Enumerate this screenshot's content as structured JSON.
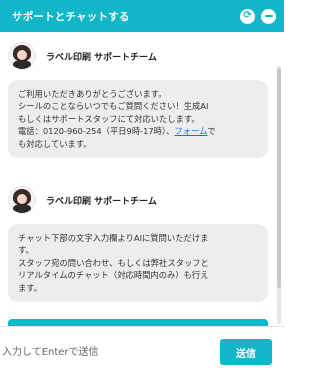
{
  "header": {
    "title": "サポートとチャットする",
    "refresh_glyph": "⟳",
    "minimize_label": "—"
  },
  "messages": [
    {
      "sender": "ラベル印刷 サポートチーム",
      "lines": [
        "ご利用いただきありがとうございます。",
        "シールのことならいつでもご質問ください！生成AI",
        "もしくはサポートスタッフにて対応いたします。"
      ],
      "phone_prefix": "電話：0120-960-254（平日9時-17時）、",
      "link_text": "フォーム",
      "phone_suffix": "で",
      "last_line": "も対応しています。"
    },
    {
      "sender": "ラベル印刷 サポートチーム",
      "lines": [
        "チャット下部の文字入力欄よりAIに質問いただけま",
        "す。",
        "スタッフ宛の問い合わせ、もしくは弊社スタッフと",
        "リアルタイムのチャット（対応時間内のみ）も行え",
        "ます。"
      ]
    }
  ],
  "input": {
    "placeholder": "入力してEnterで送信",
    "value": ""
  },
  "send_label": "送信",
  "colors": {
    "accent": "#11b6c8",
    "bubble": "#ededed",
    "link": "#1e6fd0"
  },
  "icons": {
    "refresh": "refresh-icon",
    "minimize": "minimize-icon",
    "avatar": "avatar"
  }
}
